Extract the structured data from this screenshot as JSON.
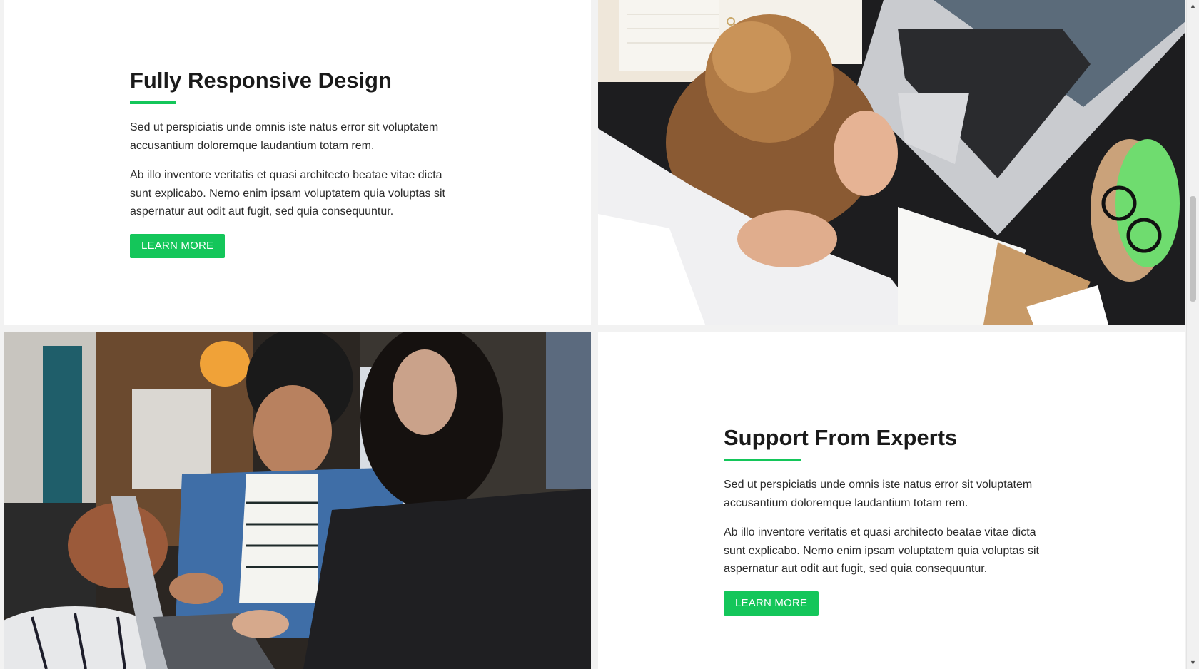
{
  "features": [
    {
      "title": "Fully Responsive Design",
      "paragraph_1": "Sed ut perspiciatis unde omnis iste natus error sit voluptatem accusantium doloremque laudantium totam rem.",
      "paragraph_2": "Ab illo inventore veritatis et quasi architecto beatae vitae dicta sunt explicabo. Nemo enim ipsam voluptatem quia voluptas sit aspernatur aut odit aut fugit, sed quia consequuntur.",
      "button_label": "LEARN MORE"
    },
    {
      "title": "Support From Experts",
      "paragraph_1": "Sed ut perspiciatis unde omnis iste natus error sit voluptatem accusantium doloremque laudantium totam rem.",
      "paragraph_2": "Ab illo inventore veritatis et quasi architecto beatae vitae dicta sunt explicabo. Nemo enim ipsam voluptatem quia voluptas sit aspernatur aut odit aut fugit, sed quia consequuntur.",
      "button_label": "LEARN MORE"
    }
  ],
  "photos": {
    "top_right": "woman-at-laptop-photo",
    "bottom_left": "two-women-laptop-photo"
  },
  "theme": {
    "accent": "#14c65a",
    "heading": "#1a1a1a",
    "body_text": "#2b2b2b",
    "background": "#f2f2f2"
  },
  "scrollbar": {
    "up_icon": "scroll-up-arrow-icon",
    "down_icon": "scroll-down-arrow-icon"
  }
}
